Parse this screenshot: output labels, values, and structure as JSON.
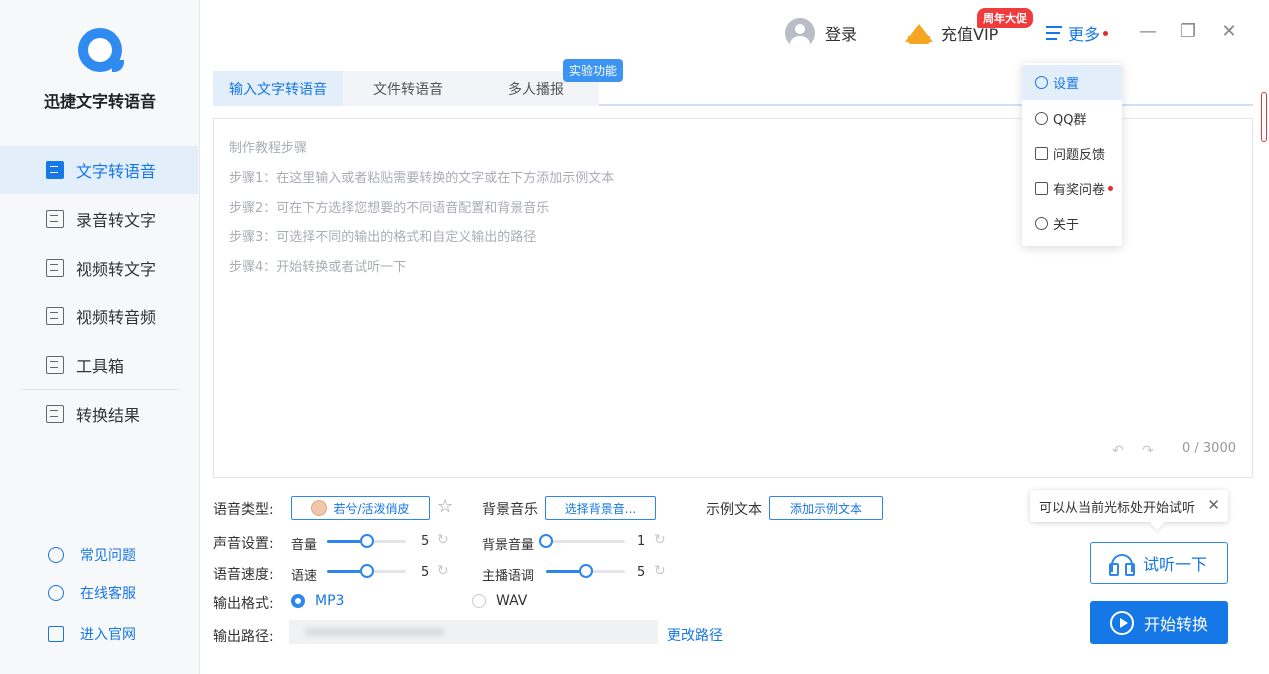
{
  "app": {
    "title": "迅捷文字转语音"
  },
  "sidebar": {
    "items": [
      {
        "label": "文字转语音",
        "icon": "text-to-speech-icon",
        "active": true
      },
      {
        "label": "录音转文字",
        "icon": "recording-to-text-icon",
        "active": false
      },
      {
        "label": "视频转文字",
        "icon": "video-to-text-icon",
        "active": false
      },
      {
        "label": "视频转音频",
        "icon": "video-to-audio-icon",
        "active": false
      },
      {
        "label": "工具箱",
        "icon": "toolbox-icon",
        "active": false
      },
      {
        "label": "转换结果",
        "icon": "results-icon",
        "active": false
      }
    ],
    "help": [
      {
        "label": "常见问题",
        "icon": "question-icon"
      },
      {
        "label": "在线客服",
        "icon": "headset-icon"
      },
      {
        "label": "进入官网",
        "icon": "monitor-icon"
      }
    ]
  },
  "topbar": {
    "login": "登录",
    "vip": "充值VIP",
    "promo": "周年大促",
    "more": "更多",
    "minimize": "—",
    "restore": "❐",
    "close": "✕"
  },
  "dropdown": {
    "items": [
      {
        "label": "设置",
        "icon": "gear-icon",
        "active": true
      },
      {
        "label": "QQ群",
        "icon": "qq-icon"
      },
      {
        "label": "问题反馈",
        "icon": "feedback-icon"
      },
      {
        "label": "有奖问卷",
        "icon": "survey-icon",
        "dot": true
      },
      {
        "label": "关于",
        "icon": "info-icon"
      }
    ]
  },
  "tabs": [
    {
      "label": "输入文字转语音",
      "active": true
    },
    {
      "label": "文件转语音"
    },
    {
      "label": "多人播报"
    }
  ],
  "experimental_tag": "实验功能",
  "editor": {
    "guide_title": "制作教程步骤",
    "steps": [
      "步骤1：在这里输入或者粘贴需要转换的文字或在下方添加示例文本",
      "步骤2：可在下方选择您想要的不同语音配置和背景音乐",
      "步骤3：可选择不同的输出的格式和自定义输出的路径",
      "步骤4：开始转换或者试听一下"
    ],
    "counter": "0 / 3000"
  },
  "settings": {
    "voice_type_label": "语音类型:",
    "voice_name": "若兮/活泼俏皮",
    "bgm_label": "背景音乐",
    "bgm_button": "选择背景音...",
    "sample_label": "示例文本",
    "sample_button": "添加示例文本",
    "sound_label": "声音设置:",
    "volume_label": "音量",
    "volume_value": "5",
    "volume_fraction": 0.5,
    "bg_volume_label": "背景音量",
    "bg_volume_value": "1",
    "bg_volume_fraction": 0.0,
    "speed_label": "语音速度:",
    "rate_label": "语速",
    "rate_value": "5",
    "rate_fraction": 0.5,
    "pitch_label": "主播语调",
    "pitch_value": "5",
    "pitch_fraction": 0.5,
    "format_label": "输出格式:",
    "format_options": [
      "MP3",
      "WAV"
    ],
    "format_selected": "MP3",
    "path_label": "输出路径:",
    "path_change": "更改路径"
  },
  "tooltip": {
    "text": "可以从当前光标处开始试听",
    "close": "✕"
  },
  "actions": {
    "listen": "试听一下",
    "convert": "开始转换"
  },
  "colors": {
    "accent": "#1677e6",
    "promo": "#ef3b3b",
    "vip_gold": "#f5a623"
  }
}
